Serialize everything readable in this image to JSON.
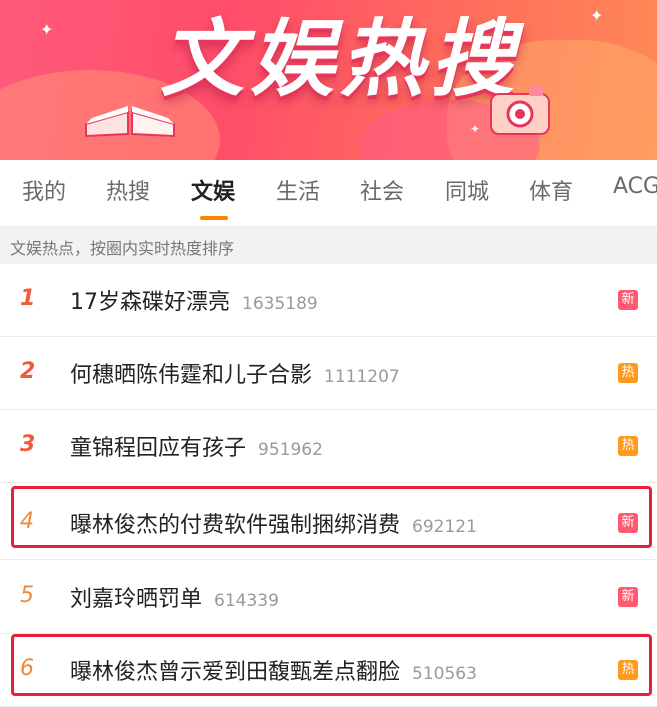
{
  "banner": {
    "title": "文娱热搜"
  },
  "tabs": [
    {
      "label": "我的"
    },
    {
      "label": "热搜"
    },
    {
      "label": "文娱"
    },
    {
      "label": "生活"
    },
    {
      "label": "社会"
    },
    {
      "label": "同城"
    },
    {
      "label": "体育"
    },
    {
      "label": "ACG"
    }
  ],
  "subtitle": "文娱热点，按圈内实时热度排序",
  "items": [
    {
      "rank": "1",
      "title": "17岁森碟好漂亮",
      "count": "1635189",
      "badge": "新"
    },
    {
      "rank": "2",
      "title": "何穗晒陈伟霆和儿子合影",
      "count": "1111207",
      "badge": "热"
    },
    {
      "rank": "3",
      "title": "童锦程回应有孩子",
      "count": "951962",
      "badge": "热"
    },
    {
      "rank": "4",
      "title": "曝林俊杰的付费软件强制捆绑消费",
      "count": "692121",
      "badge": "新"
    },
    {
      "rank": "5",
      "title": "刘嘉玲晒罚单",
      "count": "614339",
      "badge": "新"
    },
    {
      "rank": "6",
      "title": "曝林俊杰曾示爱到田馥甄差点翻脸",
      "count": "510563",
      "badge": "热"
    }
  ],
  "colors": {
    "accent": "#ff8200",
    "rank_top": "#f05a3c",
    "badge_new": "#ff5a6e",
    "badge_hot": "#ff9a1e",
    "highlight": "#e8203c"
  }
}
